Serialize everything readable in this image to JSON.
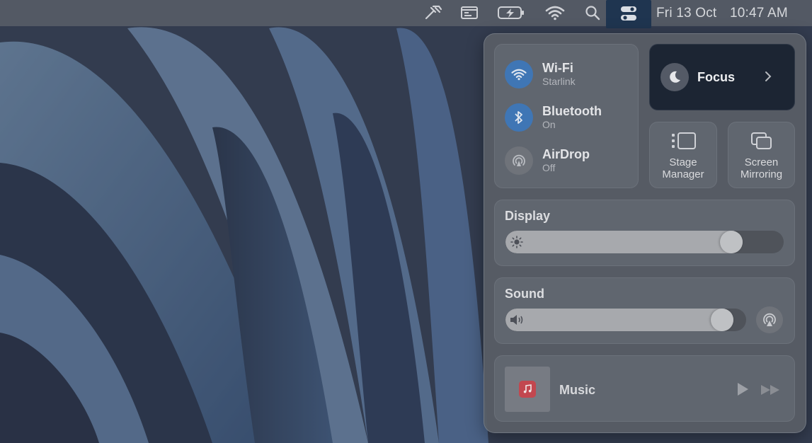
{
  "menubar": {
    "date": "Fri 13 Oct",
    "time": "10:47 AM",
    "icons": [
      "tools-icon",
      "window-icon",
      "battery-charging-icon",
      "wifi-icon",
      "search-icon",
      "control-center-icon"
    ]
  },
  "connectivity": {
    "wifi": {
      "title": "Wi-Fi",
      "subtitle": "Starlink",
      "state": "on"
    },
    "bluetooth": {
      "title": "Bluetooth",
      "subtitle": "On",
      "state": "on"
    },
    "airdrop": {
      "title": "AirDrop",
      "subtitle": "Off",
      "state": "off"
    }
  },
  "focus": {
    "label": "Focus"
  },
  "stage_manager": {
    "line1": "Stage",
    "line2": "Manager"
  },
  "screen_mirroring": {
    "line1": "Screen",
    "line2": "Mirroring"
  },
  "display": {
    "title": "Display",
    "brightness": 0.84
  },
  "sound": {
    "title": "Sound",
    "volume": 0.94
  },
  "music": {
    "label": "Music"
  },
  "colors": {
    "accent": "#3f76b5",
    "menubar_active": "#1f3550",
    "music_icon": "#c2474f"
  }
}
